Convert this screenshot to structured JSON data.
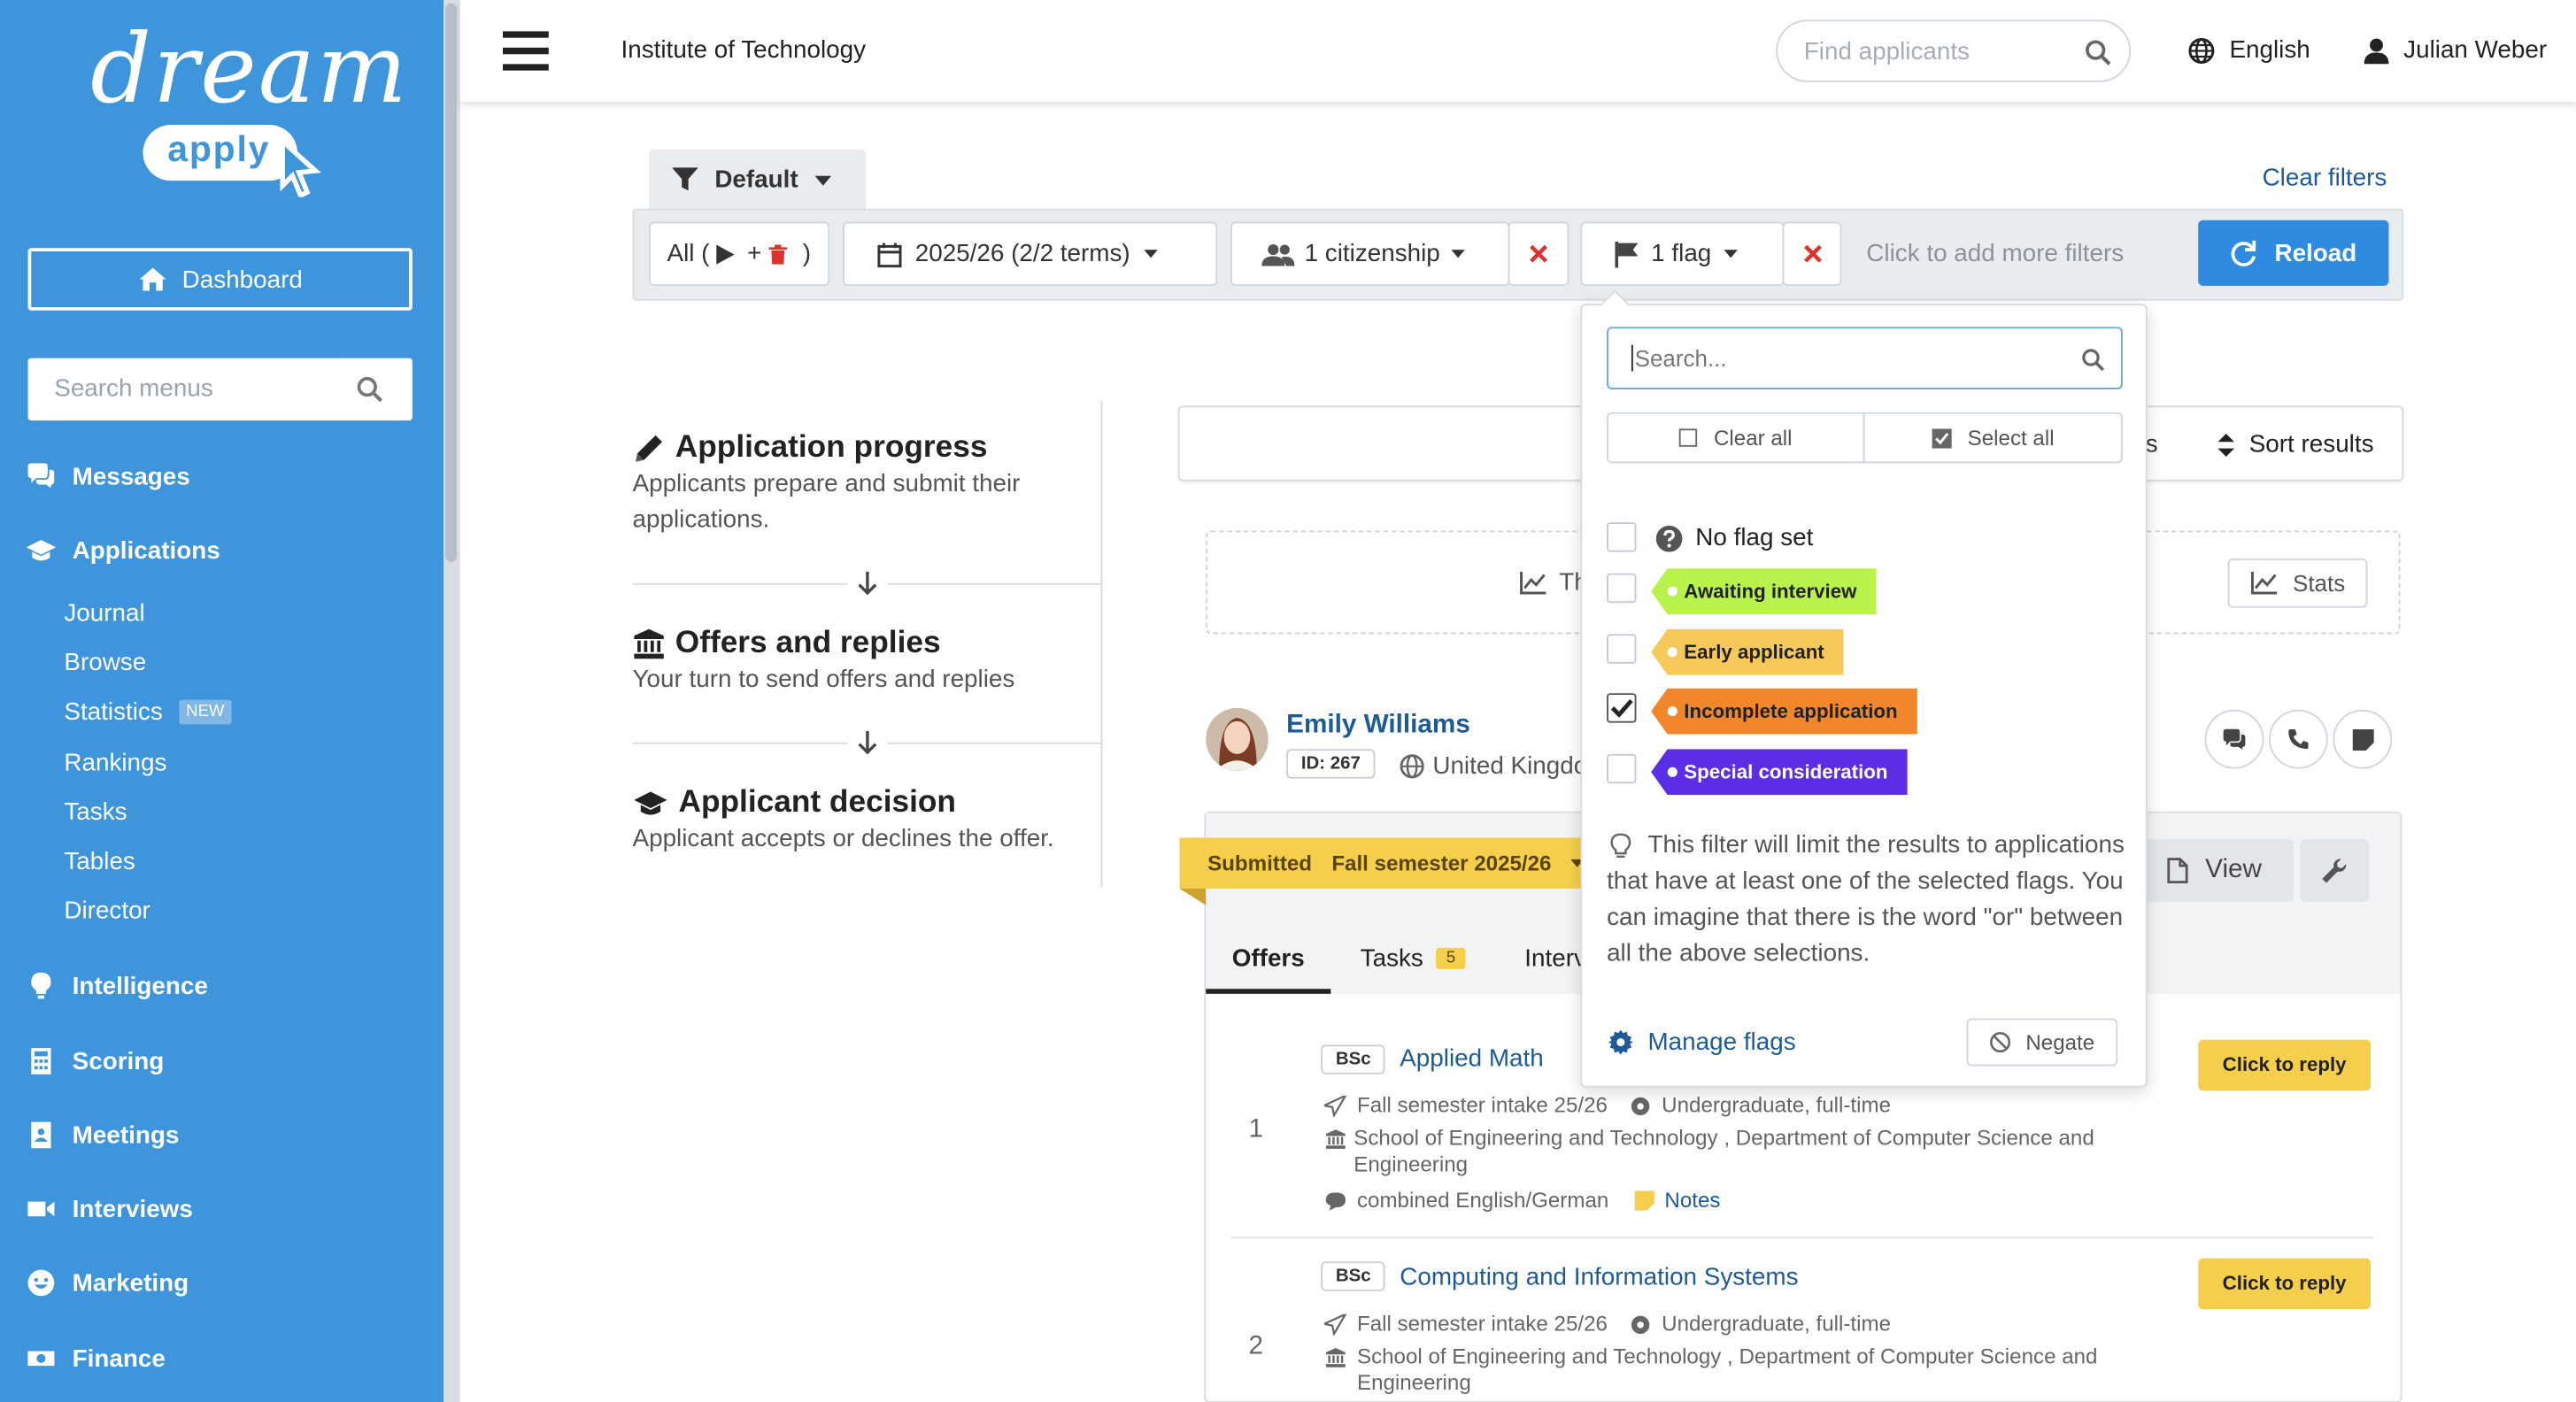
{
  "brand": {
    "logo_top": "dream",
    "logo_bottom": "apply"
  },
  "sidebar": {
    "dashboard": "Dashboard",
    "search_placeholder": "Search menus",
    "items": {
      "messages": "Messages",
      "applications": "Applications",
      "intelligence": "Intelligence",
      "scoring": "Scoring",
      "meetings": "Meetings",
      "interviews": "Interviews",
      "marketing": "Marketing",
      "finance": "Finance"
    },
    "sub": {
      "journal": "Journal",
      "browse": "Browse",
      "statistics": "Statistics",
      "statistics_badge": "NEW",
      "rankings": "Rankings",
      "tasks": "Tasks",
      "tables": "Tables",
      "director": "Director"
    }
  },
  "header": {
    "institution": "Institute of Technology",
    "search_placeholder": "Find applicants",
    "language": "English",
    "user": "Julian Weber"
  },
  "filters": {
    "preset": "Default",
    "clear": "Clear filters",
    "all_label": "All (",
    "all_plus": "+",
    "all_close": ")",
    "terms": "2025/26 (2/2 terms)",
    "citizenship": "1 citizenship",
    "flag": "1 flag",
    "add_more": "Click to add more filters",
    "reload": "Reload"
  },
  "flag_dropdown": {
    "search_placeholder": "Search...",
    "clear_all": "Clear all",
    "select_all": "Select all",
    "no_flag": "No flag set",
    "flags": [
      {
        "label": "Awaiting interview",
        "color": "#b8f24a",
        "checked": false
      },
      {
        "label": "Early applicant",
        "color": "#f7c85a",
        "checked": false
      },
      {
        "label": "Incomplete application",
        "color": "#f2862a",
        "checked": true
      },
      {
        "label": "Special consideration",
        "color": "#5b2ee6",
        "checked": false
      }
    ],
    "info": "This filter will limit the results to applications that have at least one of the selected flags. You can imagine that there is the word \"or\" between all the above selections.",
    "manage": "Manage flags",
    "negate": "Negate"
  },
  "steps": [
    {
      "title": "Application progress",
      "desc": "Applicants prepare and submit their applications."
    },
    {
      "title": "Offers and replies",
      "desc": "Your turn to send offers and replies"
    },
    {
      "title": "Applicant decision",
      "desc": "Applicant accepts or declines the offer."
    }
  ],
  "results_bar": {
    "partial": "s",
    "sort": "Sort results",
    "partial_text": "Th",
    "stats": "Stats"
  },
  "applicant": {
    "name": "Emily Williams",
    "id": "ID: 267",
    "country": "United Kingdo",
    "status": "Submitted",
    "semester": "Fall semester 2025/26",
    "view": "View",
    "tabs": {
      "offers": "Offers",
      "tasks": "Tasks",
      "tasks_count": "5",
      "interviews": "Interv"
    },
    "offers": [
      {
        "num": "1",
        "degree": "BSc",
        "program": "Applied Math",
        "intake": "Fall semester intake 25/26",
        "level": "Undergraduate, full-time",
        "school": "School of Engineering and Technology , Department of Computer Science and Engineering",
        "note": "combined English/German",
        "notes_link": "Notes",
        "reply": "Click to reply"
      },
      {
        "num": "2",
        "degree": "BSc",
        "program": "Computing and Information Systems",
        "intake": "Fall semester intake 25/26",
        "level": "Undergraduate, full-time",
        "school": "School of Engineering and Technology , Department of Computer Science and Engineering",
        "reply": "Click to reply"
      }
    ]
  }
}
